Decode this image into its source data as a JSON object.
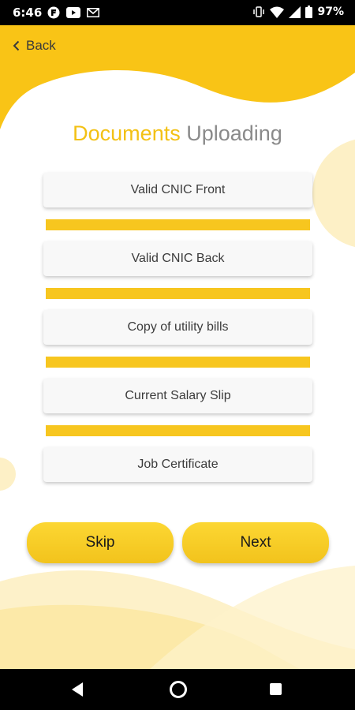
{
  "status_bar": {
    "time": "6:46",
    "left_icons": [
      "app-notification-icon",
      "youtube-icon",
      "gmail-icon"
    ],
    "right_icons": [
      "vibrate-icon",
      "wifi-icon",
      "signal-icon",
      "battery-icon"
    ],
    "battery_percent": "97%"
  },
  "header": {
    "back_label": "Back",
    "title_part1": "Documents",
    "title_part2": "Uploading"
  },
  "documents": [
    {
      "label": "Valid CNIC Front"
    },
    {
      "label": "Valid CNIC Back"
    },
    {
      "label": "Copy of utility bills"
    },
    {
      "label": "Current Salary Slip"
    },
    {
      "label": "Job Certificate"
    }
  ],
  "progress_indicators": [
    {
      "after": "Valid CNIC Front",
      "fill": 1.0
    },
    {
      "after": "Valid CNIC Back",
      "fill": 1.0
    },
    {
      "after": "Copy of utility bills",
      "fill": 1.0
    },
    {
      "after": "Current Salary Slip",
      "fill": 1.0
    }
  ],
  "actions": {
    "skip_label": "Skip",
    "next_label": "Next"
  },
  "colors": {
    "accent": "#f7c61f",
    "title_accent": "#f3c114",
    "title_muted": "#8a8a8a",
    "wave_light": "#fdf0c6"
  },
  "nav_bar": {
    "icons": [
      "nav-back-icon",
      "nav-home-icon",
      "nav-recents-icon"
    ]
  }
}
